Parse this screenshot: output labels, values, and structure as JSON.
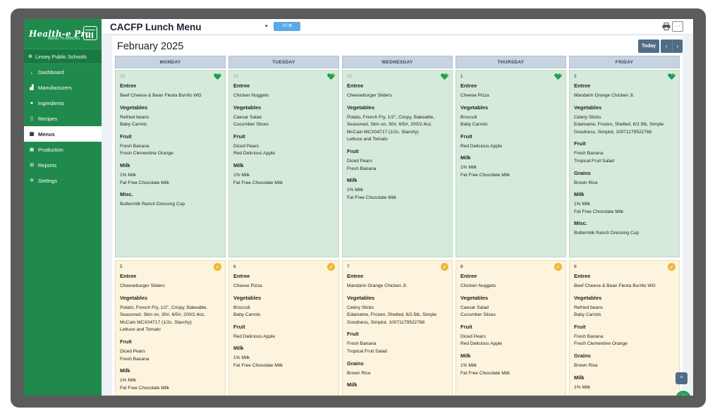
{
  "sidebar": {
    "logo_title": "Health-e Pro",
    "logo_subtitle": "MENU PLANNING",
    "school": "Linsey Public Schools",
    "items": [
      {
        "label": "Dashboard",
        "icon": "chart-icon"
      },
      {
        "label": "Manufacturers",
        "icon": "tractor-icon"
      },
      {
        "label": "Ingredients",
        "icon": "apple-icon"
      },
      {
        "label": "Recipes",
        "icon": "document-icon"
      },
      {
        "label": "Menus",
        "icon": "calendar-icon"
      },
      {
        "label": "Production",
        "icon": "clipboard-icon"
      },
      {
        "label": "Reports",
        "icon": "table-icon"
      },
      {
        "label": "Settings",
        "icon": "gear-icon"
      }
    ]
  },
  "header": {
    "title": "CACFP Lunch Menu",
    "version_label": "V2 ⧉",
    "more_label": "···"
  },
  "calendar": {
    "month_label": "February 2025",
    "today_label": "Today",
    "prev_label": "‹",
    "next_label": "›",
    "day_headers": [
      "MONDAY",
      "TUESDAY",
      "WEDNESDAY",
      "THURSDAY",
      "FRIDAY"
    ],
    "week1": [
      {
        "date": "28",
        "sections": [
          {
            "title": "Entree",
            "items": [
              "Beef Cheese & Bean Fiesta Burrito WG"
            ]
          },
          {
            "title": "Vegetables",
            "items": [
              "Refried beans",
              "Baby Carrots"
            ]
          },
          {
            "title": "Fruit",
            "items": [
              "Fresh Banana",
              "Fresh Clementine Orange"
            ]
          },
          {
            "title": "Milk",
            "items": [
              "1% Milk",
              "Fat Free Chocolate Milk"
            ]
          },
          {
            "title": "Misc.",
            "items": [
              "Buttermilk Ranch Dressing Cup"
            ]
          }
        ]
      },
      {
        "date": "29",
        "sections": [
          {
            "title": "Entree",
            "items": [
              "Chicken Nuggets"
            ]
          },
          {
            "title": "Vegetables",
            "items": [
              "Caesar Salad",
              "Cucumber Slices"
            ]
          },
          {
            "title": "Fruit",
            "items": [
              "Diced Pears",
              "Red Delicious Apple"
            ]
          },
          {
            "title": "Milk",
            "items": [
              "1% Milk",
              "Fat Free Chocolate Milk"
            ]
          }
        ]
      },
      {
        "date": "30",
        "sections": [
          {
            "title": "Entree",
            "items": [
              "Cheeseburger Sliders"
            ]
          },
          {
            "title": "Vegetables",
            "items": [
              "Potato, French Fry, 1/2\", Crispy, Bakeable,",
              "Seasoned, Skin on, 30#, 6/5#, 200/2.4oz,",
              "McCain MCX04717 (1/2c. Starchy)",
              "Lettuce and Tomato"
            ]
          },
          {
            "title": "Fruit",
            "items": [
              "Diced Pears",
              "Fresh Banana"
            ]
          },
          {
            "title": "Milk",
            "items": [
              "1% Milk",
              "Fat Free Chocolate Milk"
            ]
          }
        ]
      },
      {
        "date": "1",
        "sections": [
          {
            "title": "Entree",
            "items": [
              "Cheese Pizza"
            ]
          },
          {
            "title": "Vegetables",
            "items": [
              "Broccoli",
              "Baby Carrots"
            ]
          },
          {
            "title": "Fruit",
            "items": [
              "Red Delicious Apple"
            ]
          },
          {
            "title": "Milk",
            "items": [
              "1% Milk",
              "Fat Free Chocolate Milk"
            ]
          }
        ]
      },
      {
        "date": "2",
        "sections": [
          {
            "title": "Entree",
            "items": [
              "Mandarin Orange Chicken Jr."
            ]
          },
          {
            "title": "Vegetables",
            "items": [
              "Celery Sticks",
              "Edamame, Frozen, Shelled, 6/2.5lb, Simple",
              "Goodness, Simplot, 10071179522768"
            ]
          },
          {
            "title": "Fruit",
            "items": [
              "Fresh Banana",
              "Tropical Fruit Salad"
            ]
          },
          {
            "title": "Grains",
            "items": [
              "Brown Rice"
            ]
          },
          {
            "title": "Milk",
            "items": [
              "1% Milk",
              "Fat Free Chocolate Milk"
            ]
          },
          {
            "title": "Misc.",
            "items": [
              "Buttermilk Ranch Dressing Cup"
            ]
          }
        ]
      }
    ],
    "week2": [
      {
        "date": "5",
        "sections": [
          {
            "title": "Entree",
            "items": [
              "Cheeseburger Sliders"
            ]
          },
          {
            "title": "Vegetables",
            "items": [
              "Potato, French Fry, 1/2\", Crispy, Bakeable,",
              "Seasoned, Skin on, 30#, 6/5#, 200/2.4oz,",
              "McCain MCX04717 (1/2c. Starchy)",
              "Lettuce and Tomato"
            ]
          },
          {
            "title": "Fruit",
            "items": [
              "Diced Pears",
              "Fresh Banana"
            ]
          },
          {
            "title": "Milk",
            "items": [
              "1% Milk",
              "Fat Free Chocolate Milk"
            ]
          }
        ]
      },
      {
        "date": "6",
        "sections": [
          {
            "title": "Entree",
            "items": [
              "Cheese Pizza"
            ]
          },
          {
            "title": "Vegetables",
            "items": [
              "Broccoli",
              "Baby Carrots"
            ]
          },
          {
            "title": "Fruit",
            "items": [
              "Red Delicious Apple"
            ]
          },
          {
            "title": "Milk",
            "items": [
              "1% Milk",
              "Fat Free Chocolate Milk"
            ]
          }
        ]
      },
      {
        "date": "7",
        "sections": [
          {
            "title": "Entree",
            "items": [
              "Mandarin Orange Chicken Jr."
            ]
          },
          {
            "title": "Vegetables",
            "items": [
              "Celery Sticks",
              "Edamame, Frozen, Shelled, 6/2.5lb, Simple",
              "Goodness, Simplot, 10071179522768"
            ]
          },
          {
            "title": "Fruit",
            "items": [
              "Fresh Banana",
              "Tropical Fruit Salad"
            ]
          },
          {
            "title": "Grains",
            "items": [
              "Brown Rice"
            ]
          },
          {
            "title": "Milk",
            "items": []
          }
        ]
      },
      {
        "date": "8",
        "sections": [
          {
            "title": "Entree",
            "items": [
              "Chicken Nuggets"
            ]
          },
          {
            "title": "Vegetables",
            "items": [
              "Caesar Salad",
              "Cucumber Slices"
            ]
          },
          {
            "title": "Fruit",
            "items": [
              "Diced Pears",
              "Red Delicious Apple"
            ]
          },
          {
            "title": "Milk",
            "items": [
              "1% Milk",
              "Fat Free Chocolate Milk"
            ]
          }
        ]
      },
      {
        "date": "9",
        "sections": [
          {
            "title": "Entree",
            "items": [
              "Beef Cheese & Bean Fiesta Burrito WG"
            ]
          },
          {
            "title": "Vegetables",
            "items": [
              "Refried beans",
              "Baby Carrots"
            ]
          },
          {
            "title": "Fruit",
            "items": [
              "Fresh Banana",
              "Fresh Clementine Orange"
            ]
          },
          {
            "title": "Grains",
            "items": [
              "Brown Rice"
            ]
          },
          {
            "title": "Milk",
            "items": [
              "1% Milk"
            ]
          }
        ]
      }
    ]
  },
  "floating": {
    "scroll_top_label": "^",
    "help_label": "?"
  },
  "colors": {
    "sidebar": "#1f8a4c",
    "week_approved": "#d6eadb",
    "week_pending": "#fcf4dc",
    "check_badge": "#f0b632",
    "heart_badge": "#1e9e55",
    "nav_button": "#4f6d86"
  }
}
